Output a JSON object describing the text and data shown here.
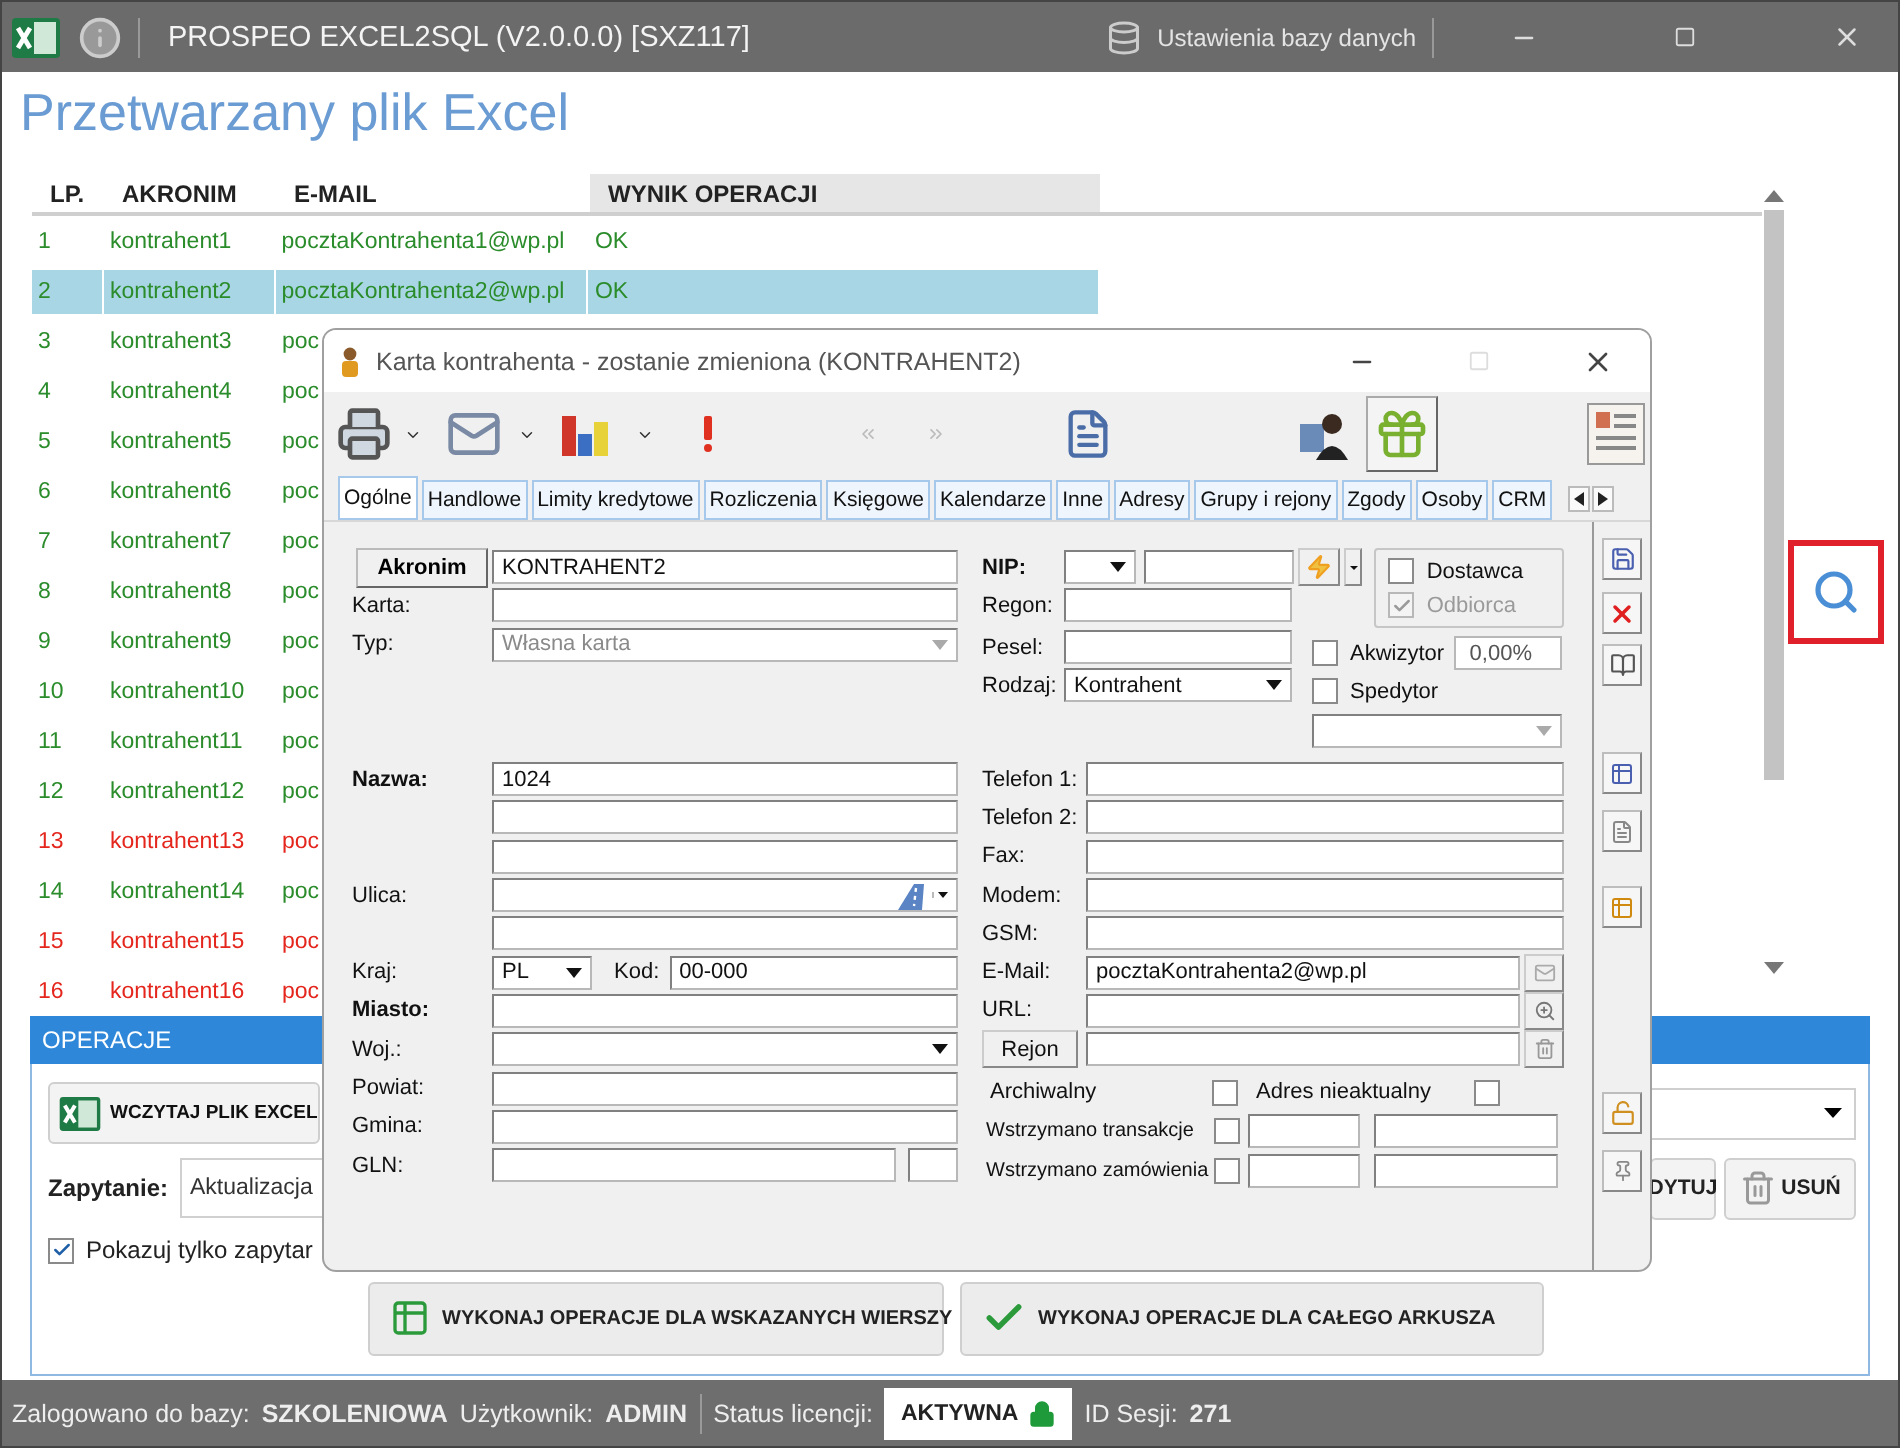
{
  "window": {
    "title": "PROSPEO EXCEL2SQL (V2.0.0.0) [SXZ117]",
    "settings_link": "Ustawienia bazy danych"
  },
  "heading": "Przetwarzany plik Excel",
  "table": {
    "columns": [
      "LP.",
      "AKRONIM",
      "E-MAIL",
      "WYNIK OPERACJI"
    ],
    "rows": [
      {
        "lp": "1",
        "akronim": "kontrahent1",
        "email": "pocztaKontrahenta1@wp.pl",
        "result": "OK",
        "selected": false,
        "error": false
      },
      {
        "lp": "2",
        "akronim": "kontrahent2",
        "email": "pocztaKontrahenta2@wp.pl",
        "result": "OK",
        "selected": true,
        "error": false
      },
      {
        "lp": "3",
        "akronim": "kontrahent3",
        "email": "poc",
        "selected": false,
        "error": false
      },
      {
        "lp": "4",
        "akronim": "kontrahent4",
        "email": "poc",
        "selected": false,
        "error": false
      },
      {
        "lp": "5",
        "akronim": "kontrahent5",
        "email": "poc",
        "selected": false,
        "error": false
      },
      {
        "lp": "6",
        "akronim": "kontrahent6",
        "email": "poc",
        "selected": false,
        "error": false
      },
      {
        "lp": "7",
        "akronim": "kontrahent7",
        "email": "poc",
        "selected": false,
        "error": false
      },
      {
        "lp": "8",
        "akronim": "kontrahent8",
        "email": "poc",
        "selected": false,
        "error": false
      },
      {
        "lp": "9",
        "akronim": "kontrahent9",
        "email": "poc",
        "selected": false,
        "error": false
      },
      {
        "lp": "10",
        "akronim": "kontrahent10",
        "email": "poc",
        "selected": false,
        "error": false
      },
      {
        "lp": "11",
        "akronim": "kontrahent11",
        "email": "poc",
        "selected": false,
        "error": false
      },
      {
        "lp": "12",
        "akronim": "kontrahent12",
        "email": "poc",
        "selected": false,
        "error": false
      },
      {
        "lp": "13",
        "akronim": "kontrahent13",
        "email": "poc",
        "selected": false,
        "error": true
      },
      {
        "lp": "14",
        "akronim": "kontrahent14",
        "email": "poc",
        "selected": false,
        "error": false
      },
      {
        "lp": "15",
        "akronim": "kontrahent15",
        "email": "poc",
        "selected": false,
        "error": true
      },
      {
        "lp": "16",
        "akronim": "kontrahent16",
        "email": "poc",
        "selected": false,
        "error": true
      }
    ]
  },
  "operations": {
    "title": "OPERACJE",
    "load_button": "WCZYTAJ PLIK EXCEL",
    "query_label": "Zapytanie:",
    "query_value": "Aktualizacja",
    "only_queries": {
      "label": "Pokazuj tylko zapytar",
      "checked": true
    },
    "edit_button": "DYTUJ",
    "delete_button": "USUŃ",
    "run_selected": "WYKONAJ OPERACJE DLA WSKAZANYCH WIERSZY",
    "run_sheet": "WYKONAJ OPERACJE DLA CAŁEGO ARKUSZA"
  },
  "status_bar": {
    "items": [
      {
        "label": "Zalogowano do bazy:",
        "value": "SZKOLENIOWA"
      },
      {
        "label": "Użytkownik:",
        "value": "ADMIN"
      }
    ],
    "license_label": "Status licencji:",
    "license_value": "AKTYWNA",
    "session_label": "ID Sesji:",
    "session_value": "271"
  },
  "dialog": {
    "title": "Karta kontrahenta - zostanie zmieniona (KONTRAHENT2)",
    "tabs": [
      {
        "label": "Ogólne",
        "selected": true
      },
      {
        "label": "Handlowe",
        "selected": false
      },
      {
        "label": "Limity kredytowe",
        "selected": false
      },
      {
        "label": "Rozliczenia",
        "selected": false
      },
      {
        "label": "Księgowe",
        "selected": false
      },
      {
        "label": "Kalendarze",
        "selected": false
      },
      {
        "label": "Inne",
        "selected": false
      },
      {
        "label": "Adresy",
        "selected": false
      },
      {
        "label": "Grupy i rejony",
        "selected": false
      },
      {
        "label": "Zgody",
        "selected": false
      },
      {
        "label": "Osoby",
        "selected": false
      },
      {
        "label": "CRM",
        "selected": false
      }
    ],
    "akronim": {
      "button": "Akronim",
      "value": "KONTRAHENT2"
    },
    "identity_fields": [
      {
        "kind": "text",
        "label": "Karta:"
      },
      {
        "kind": "select",
        "label": "Typ:",
        "value": "Własna karta",
        "disabled": true
      }
    ],
    "address_fields": [
      {
        "kind": "text",
        "label": "Nazwa:",
        "bold": true,
        "value": "1024"
      },
      {
        "kind": "text"
      },
      {
        "kind": "text"
      },
      {
        "kind": "street",
        "label": "Ulica:"
      },
      {
        "kind": "text"
      },
      {
        "kind": "country",
        "label": "Kraj:",
        "value": "PL",
        "code_label": "Kod:",
        "code_value": "00-000"
      },
      {
        "kind": "text",
        "label": "Miasto:",
        "bold": true
      },
      {
        "kind": "select",
        "label": "Woj.:",
        "disabled": false
      },
      {
        "kind": "text",
        "label": "Powiat:"
      },
      {
        "kind": "text",
        "label": "Gmina:"
      },
      {
        "kind": "split",
        "label": "GLN:"
      }
    ],
    "nip_label": "NIP:",
    "regon_label": "Regon:",
    "pesel_label": "Pesel:",
    "rodzaj": {
      "label": "Rodzaj:",
      "value": "Kontrahent"
    },
    "roles": [
      {
        "label": "Dostawca",
        "checked": false,
        "disabled": false
      },
      {
        "label": "Odbiorca",
        "checked": true,
        "disabled": true
      }
    ],
    "akwizytor": {
      "label": "Akwizytor",
      "checked": false,
      "percent": "0,00%"
    },
    "spedytor": {
      "label": "Spedytor",
      "checked": false
    },
    "contact_fields": [
      {
        "kind": "text",
        "label": "Telefon 1:"
      },
      {
        "kind": "text",
        "label": "Telefon 2:"
      },
      {
        "kind": "text",
        "label": "Fax:"
      },
      {
        "kind": "text",
        "label": "Modem:"
      },
      {
        "kind": "text",
        "label": "GSM:"
      },
      {
        "kind": "email",
        "label": "E-Mail:",
        "value": "pocztaKontrahenta2@wp.pl"
      },
      {
        "kind": "url",
        "label": "URL:"
      },
      {
        "kind": "button",
        "label": "Rejon"
      }
    ],
    "flags": [
      {
        "label": "Archiwalny",
        "checked": false
      },
      {
        "label": "Adres nieaktualny",
        "checked": false
      }
    ],
    "holds": [
      {
        "label": "Wstrzymano transakcje",
        "checked": false
      },
      {
        "label": "Wstrzymano zamówienia",
        "checked": false
      }
    ]
  }
}
